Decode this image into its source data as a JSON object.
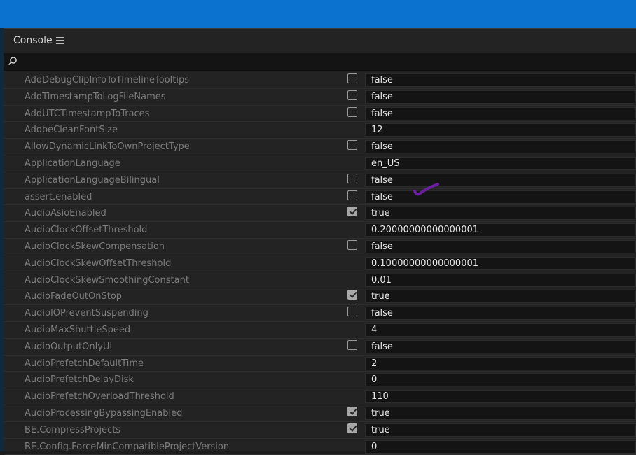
{
  "panel": {
    "title": "Console"
  },
  "filter": {
    "value": ""
  },
  "rows": [
    {
      "name": "AddDebugClipInfoToTimelineTooltips",
      "value": "false",
      "checkbox": true,
      "checked": false
    },
    {
      "name": "AddTimestampToLogFileNames",
      "value": "false",
      "checkbox": true,
      "checked": false
    },
    {
      "name": "AddUTCTimestampToTraces",
      "value": "false",
      "checkbox": true,
      "checked": false
    },
    {
      "name": "AdobeCleanFontSize",
      "value": "12",
      "checkbox": false,
      "checked": false
    },
    {
      "name": "AllowDynamicLinkToOwnProjectType",
      "value": "false",
      "checkbox": true,
      "checked": false
    },
    {
      "name": "ApplicationLanguage",
      "value": "en_US",
      "checkbox": false,
      "checked": false
    },
    {
      "name": "ApplicationLanguageBilingual",
      "value": "false",
      "checkbox": true,
      "checked": false
    },
    {
      "name": "assert.enabled",
      "value": "false",
      "checkbox": true,
      "checked": false
    },
    {
      "name": "AudioAsioEnabled",
      "value": "true",
      "checkbox": true,
      "checked": true
    },
    {
      "name": "AudioClockOffsetThreshold",
      "value": "0.20000000000000001",
      "checkbox": false,
      "checked": false
    },
    {
      "name": "AudioClockSkewCompensation",
      "value": "false",
      "checkbox": true,
      "checked": false
    },
    {
      "name": "AudioClockSkewOffsetThreshold",
      "value": "0.10000000000000001",
      "checkbox": false,
      "checked": false
    },
    {
      "name": "AudioClockSkewSmoothingConstant",
      "value": "0.01",
      "checkbox": false,
      "checked": false
    },
    {
      "name": "AudioFadeOutOnStop",
      "value": "true",
      "checkbox": true,
      "checked": true
    },
    {
      "name": "AudioIOPreventSuspending",
      "value": "false",
      "checkbox": true,
      "checked": false
    },
    {
      "name": "AudioMaxShuttleSpeed",
      "value": "4",
      "checkbox": false,
      "checked": false
    },
    {
      "name": "AudioOutputOnlyUI",
      "value": "false",
      "checkbox": true,
      "checked": false
    },
    {
      "name": "AudioPrefetchDefaultTime",
      "value": "2",
      "checkbox": false,
      "checked": false
    },
    {
      "name": "AudioPrefetchDelayDisk",
      "value": "0",
      "checkbox": false,
      "checked": false
    },
    {
      "name": "AudioPrefetchOverloadThreshold",
      "value": "110",
      "checkbox": false,
      "checked": false
    },
    {
      "name": "AudioProcessingBypassingEnabled",
      "value": "true",
      "checkbox": true,
      "checked": true
    },
    {
      "name": "BE.CompressProjects",
      "value": "true",
      "checkbox": true,
      "checked": true
    },
    {
      "name": "BE.Config.ForceMinCompatibleProjectVersion",
      "value": "0",
      "checkbox": false,
      "checked": false
    }
  ],
  "annotation": {
    "color": "#6a1fa0"
  }
}
